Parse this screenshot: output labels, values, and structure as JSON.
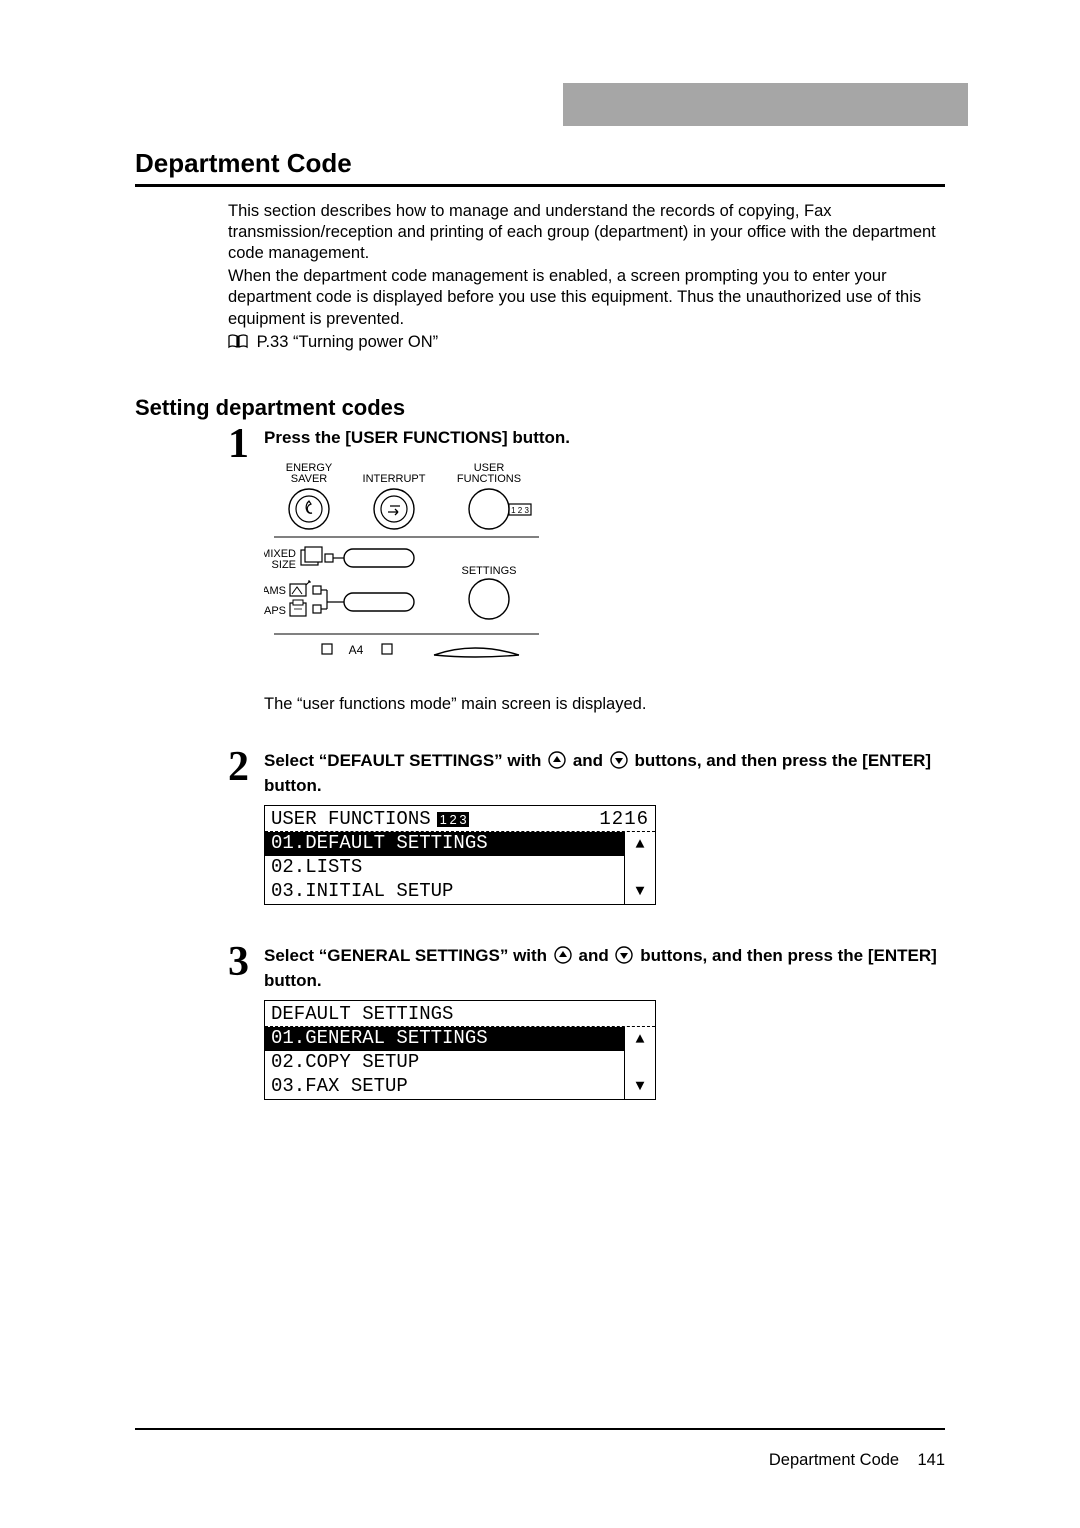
{
  "sideTab": {
    "present": true
  },
  "heading": "Department Code",
  "intro": {
    "p1": "This section describes how to manage and understand the records of copying, Fax transmission/reception and printing of each group (department) in your office with the department code management.",
    "p2": "When the department code management is enabled, a screen prompting you to enter your department code is displayed before you use this equipment. Thus the unauthorized use of this equipment is prevented.",
    "ref": "P.33 “Turning power ON”"
  },
  "subheading": "Setting department codes",
  "step1": {
    "title": "Press the [USER FUNCTIONS] button.",
    "panel": {
      "labels": {
        "energySaverTop": "ENERGY",
        "energySaverBottom": "SAVER",
        "interrupt": "INTERRUPT",
        "userTop": "USER",
        "userBottom": "FUNCTIONS",
        "settings": "SETTINGS",
        "mixedTop": "MIXED",
        "mixedBottom": "SIZE",
        "ams": "AMS",
        "aps": "APS",
        "a4": "A4",
        "tiny123": "1 2 3"
      }
    },
    "caption": "The “user functions mode” main screen is displayed."
  },
  "step2": {
    "title_a": "Select “DEFAULT SETTINGS” with ",
    "title_mid": " and ",
    "title_b": " buttons, and then press the [ENTER] button.",
    "lcd": {
      "headerTitle": "USER FUNCTIONS",
      "headerBadge": "1 2 3",
      "headerRight": "1216",
      "rows": [
        {
          "text": "01.DEFAULT SETTINGS",
          "selected": true
        },
        {
          "text": "02.LISTS",
          "selected": false
        },
        {
          "text": "03.INITIAL SETUP",
          "selected": false
        }
      ]
    }
  },
  "step3": {
    "title_a": "Select “GENERAL SETTINGS” with ",
    "title_mid": " and ",
    "title_b": " buttons, and then press the [ENTER] button.",
    "lcd": {
      "headerTitle": "DEFAULT SETTINGS",
      "rows": [
        {
          "text": "01.GENERAL SETTINGS",
          "selected": true
        },
        {
          "text": "02.COPY SETUP",
          "selected": false
        },
        {
          "text": "03.FAX SETUP",
          "selected": false
        }
      ]
    }
  },
  "footer": {
    "label": "Department Code",
    "page": "141"
  }
}
